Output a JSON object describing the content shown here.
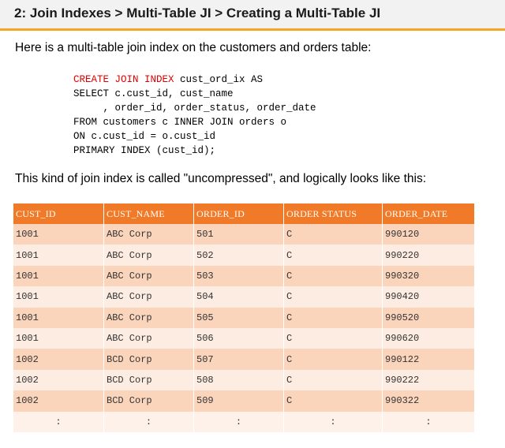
{
  "header": {
    "title": "2: Join Indexes > Multi-Table JI > Creating a Multi-Table JI"
  },
  "intro": "Here is a multi-table join index on the customers and orders table:",
  "code": {
    "line1_kw": "CREATE JOIN INDEX",
    "line1_rest": " cust_ord_ix AS",
    "line2": "SELECT c.cust_id, cust_name",
    "line3": "     , order_id, order_status, order_date",
    "line4": "FROM customers c INNER JOIN orders o",
    "line5": "ON c.cust_id = o.cust_id",
    "line6": "PRIMARY INDEX (cust_id);"
  },
  "summary": "This kind of join index is called \"uncompressed\", and logically looks like this:",
  "table": {
    "headers": [
      "CUST_ID",
      "CUST_NAME",
      "ORDER_ID",
      "ORDER STATUS",
      "ORDER_DATE"
    ],
    "rows": [
      [
        "1001",
        "ABC Corp",
        "501",
        "C",
        "990120"
      ],
      [
        "1001",
        "ABC Corp",
        "502",
        "C",
        "990220"
      ],
      [
        "1001",
        "ABC Corp",
        "503",
        "C",
        "990320"
      ],
      [
        "1001",
        "ABC Corp",
        "504",
        "C",
        "990420"
      ],
      [
        "1001",
        "ABC Corp",
        "505",
        "C",
        "990520"
      ],
      [
        "1001",
        "ABC Corp",
        "506",
        "C",
        "990620"
      ],
      [
        "1002",
        "BCD Corp",
        "507",
        "C",
        "990122"
      ],
      [
        "1002",
        "BCD Corp",
        "508",
        "C",
        "990222"
      ],
      [
        "1002",
        "BCD Corp",
        "509",
        "C",
        "990322"
      ]
    ],
    "continuation": [
      ":",
      ":",
      ":",
      ":",
      ":"
    ]
  },
  "colors": {
    "accent": "#f5a623",
    "header_cell": "#f07a27",
    "row_dark": "#fad4bb",
    "row_light": "#fdece1"
  }
}
